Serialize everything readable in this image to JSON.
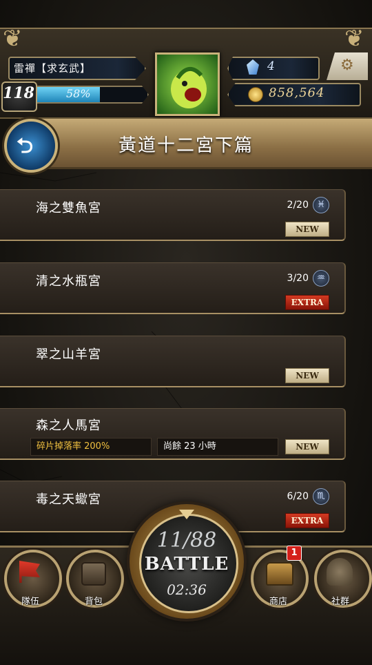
{
  "player": {
    "name": "雷禪【求玄武】",
    "level": "118",
    "exp_percent": "58%",
    "exp_fraction": 0.58,
    "gems": "4",
    "coins": "858,564"
  },
  "header": {
    "title": "黃道十二宮下篇"
  },
  "stages": [
    {
      "name": "海之雙魚宮",
      "count": "2/20",
      "zodiac_glyph": "♓",
      "tag": "NEW",
      "tag_type": "new"
    },
    {
      "name": "清之水瓶宮",
      "count": "3/20",
      "zodiac_glyph": "♒",
      "tag": "EXTRA",
      "tag_type": "extra"
    },
    {
      "name": "翠之山羊宮",
      "count": "",
      "zodiac_glyph": "",
      "tag": "NEW",
      "tag_type": "new"
    },
    {
      "name": "森之人馬宮",
      "count": "",
      "zodiac_glyph": "",
      "tag": "NEW",
      "tag_type": "new",
      "drop_rate": "碎片掉落率 200%",
      "time_left": "尚餘 23 小時"
    },
    {
      "name": "毒之天蠍宮",
      "count": "6/20",
      "zodiac_glyph": "♏",
      "tag": "EXTRA",
      "tag_type": "extra"
    }
  ],
  "battle": {
    "count": "11/88",
    "label": "BATTLE",
    "timer": "02:36"
  },
  "nav": {
    "team": "隊伍",
    "bag": "背包",
    "shop": "商店",
    "shop_badge": "1",
    "community": "社群"
  },
  "colors": {
    "tag_new": "#efe4c6",
    "tag_extra": "#c22a18",
    "drop_rate_text": "#f0c040",
    "exp_fill": "#3aa8d8"
  }
}
